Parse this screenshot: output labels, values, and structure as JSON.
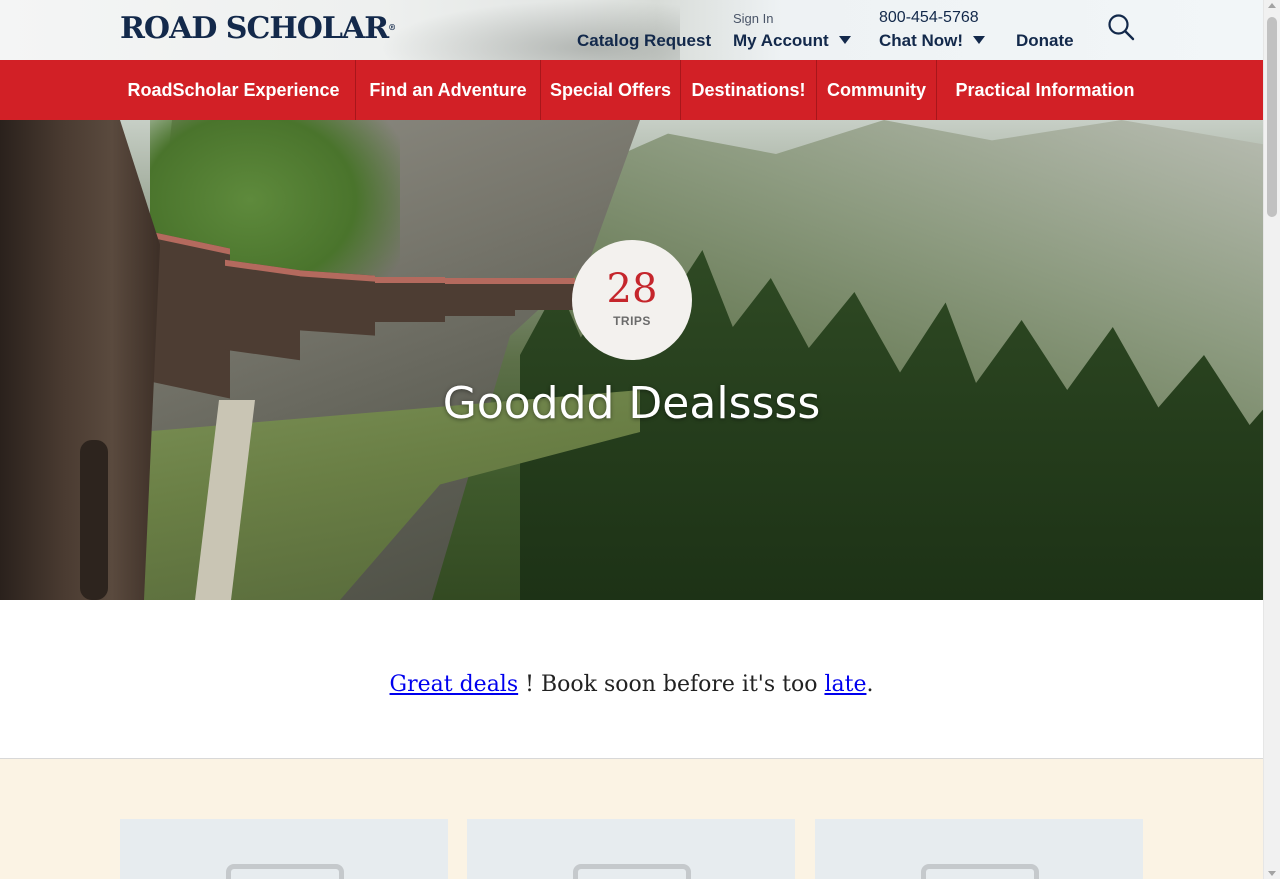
{
  "header": {
    "logo_text": "ROAD SCHOLAR",
    "logo_mark": "®",
    "catalog_request": "Catalog Request",
    "sign_in": "Sign In",
    "my_account": "My Account",
    "phone": "800-454-5768",
    "chat_now": "Chat Now!",
    "donate": "Donate",
    "search_icon": "search-icon"
  },
  "nav": {
    "items": [
      {
        "label": "RoadScholar Experience"
      },
      {
        "label": "Find an Adventure"
      },
      {
        "label": "Special Offers"
      },
      {
        "label": "Destinations!"
      },
      {
        "label": "Community"
      },
      {
        "label": "Practical Information"
      }
    ]
  },
  "hero": {
    "trip_count": "28",
    "trip_label": "TRIPS",
    "title": "Gooddd Dealssss"
  },
  "intro": {
    "link1": "Great deals",
    "text1": " ! Book soon before it's too ",
    "link2": "late",
    "text2": "."
  },
  "cards": [
    {
      "icon": "image-placeholder-icon"
    },
    {
      "icon": "image-placeholder-icon"
    },
    {
      "icon": "image-placeholder-icon"
    }
  ],
  "colors": {
    "brand_navy": "#13294b",
    "nav_red": "#d22026",
    "badge_red": "#c5262c",
    "cards_bg": "#fbf3e4"
  }
}
